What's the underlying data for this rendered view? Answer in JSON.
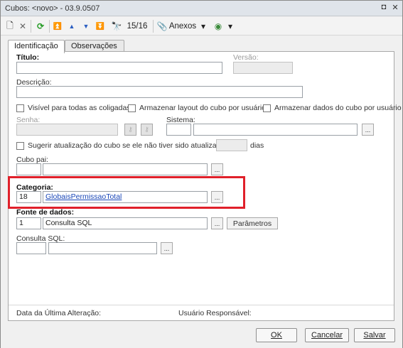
{
  "window": {
    "title": "Cubos: <novo> - 03.9.0507",
    "pin": "◘",
    "close": "✕"
  },
  "toolbar": {
    "new": "🗋",
    "delete": "✕",
    "refresh": "⟳",
    "first": "⏫",
    "prev": "▲",
    "next": "▼",
    "last": "⏬",
    "find": "🔭",
    "record_counter": "15/16",
    "attachments_icon": "📎",
    "attachments_label": "Anexos",
    "dropdown": "▾",
    "globe": "◉",
    "dropdown2": "▾"
  },
  "tabs": [
    "Identificação",
    "Observações"
  ],
  "form": {
    "titulo_label": "Título:",
    "versao_label": "Versão:",
    "descricao_label": "Descrição:",
    "visivel_label": "Visível para  todas as coligadas",
    "armazenar_layout_label": "Armazenar layout do cubo por usuário",
    "armazenar_dados_label": "Armazenar dados do cubo por usuário",
    "senha_label": "Senha:",
    "sistema_label": "Sistema:",
    "sugerir_label": "Sugerir atualização do cubo se ele não tiver sido atualizado há",
    "dias_label": "dias",
    "cubo_pai_label": "Cubo pai:",
    "categoria_label": "Categoria:",
    "categoria_code": "18",
    "categoria_name": "GlobaisPermissaoTotal",
    "fonte_label": "Fonte de dados:",
    "fonte_code": "1",
    "fonte_name": "Consulta SQL",
    "parametros_label": "Parâmetros",
    "consulta_label": "Consulta SQL:",
    "lookup": "...",
    "data_alteracao_label": "Data da Última Alteração:",
    "usuario_label": "Usuário Responsável:"
  },
  "footer": {
    "ok": "OK",
    "cancelar": "Cancelar",
    "salvar": "Salvar"
  },
  "colors": {
    "highlight": "#e0202a",
    "link": "#1a47b8"
  }
}
